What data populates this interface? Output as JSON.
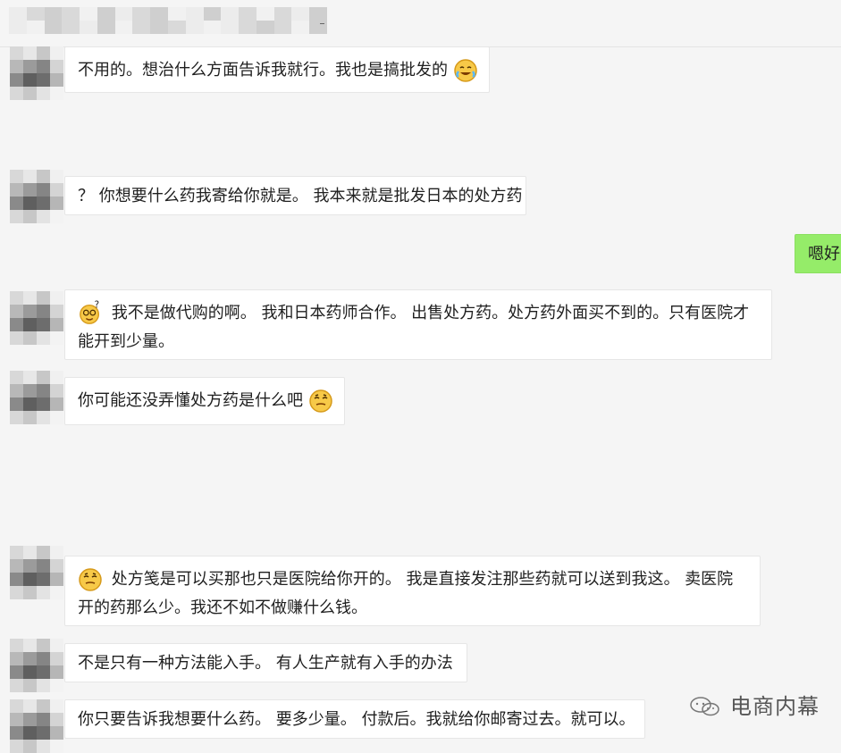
{
  "watermark": {
    "text": "电商内幕"
  },
  "messages": [
    {
      "text": "不用的。想治什么方面告诉我就行。我也是搞批发的 "
    },
    {
      "text": "？ 你想要什么药我寄给你就是。 我本来就是批发日本的处方药"
    },
    {
      "text": "嗯好"
    },
    {
      "text": "我不是做代购的啊。 我和日本药师合作。 出售处方药。处方药外面买不到的。只有医院才能开到少量。"
    },
    {
      "text": "你可能还没弄懂处方药是什么吧"
    },
    {
      "text": "处方笺是可以买那也只是医院给你开的。 我是直接发注那些药就可以送到我这。 卖医院开的药那么少。我还不如不做赚什么钱。"
    },
    {
      "text": "不是只有一种方法能入手。 有人生产就有入手的办法"
    },
    {
      "text": "你只要告诉我想要什么药。 要多少量。 付款后。我就给你邮寄过去。就可以。"
    }
  ],
  "icons": {
    "emoji_1": "laughing-tears-emoji-icon",
    "emoji_2": "dizzy-question-emoji-icon",
    "emoji_3": "smug-emoji-icon",
    "watermark_logo": "wechat-logo-icon"
  }
}
